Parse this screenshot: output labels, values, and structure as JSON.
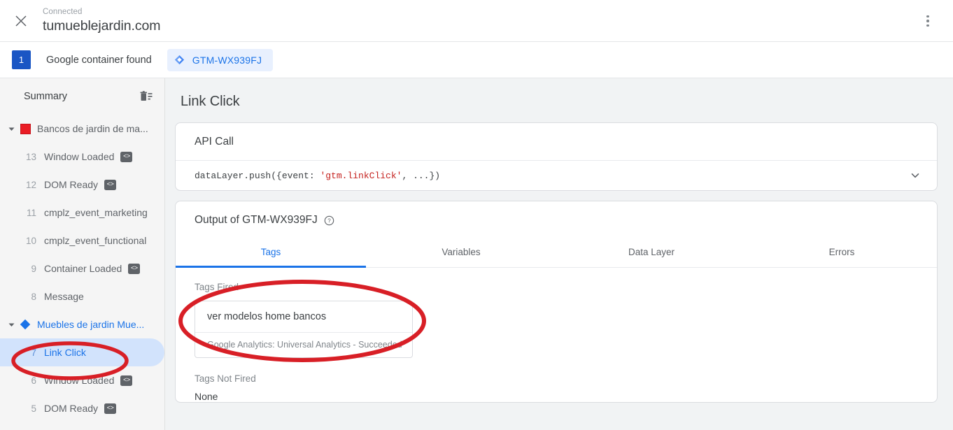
{
  "topbar": {
    "close_icon": "close-icon",
    "connection_status": "Connected",
    "domain": "tumueblejardin.com",
    "menu_icon": "more-vert-icon"
  },
  "container_bar": {
    "count": "1",
    "label": "Google container found",
    "chip_icon": "tag-manager-diamond-icon",
    "chip_id": "GTM-WX939FJ"
  },
  "sidebar": {
    "summary_label": "Summary",
    "clear_icon": "delete-list-icon",
    "groups": [
      {
        "caret": "caret-down-icon",
        "icon": "red-square-icon",
        "label": "Bancos de jardin de ma...",
        "events": [
          {
            "num": "13",
            "name": "Window Loaded",
            "badge": "<>"
          },
          {
            "num": "12",
            "name": "DOM Ready",
            "badge": "<>"
          },
          {
            "num": "11",
            "name": "cmplz_event_marketing",
            "badge": ""
          },
          {
            "num": "10",
            "name": "cmplz_event_functional",
            "badge": ""
          },
          {
            "num": "9",
            "name": "Container Loaded",
            "badge": "<>"
          },
          {
            "num": "8",
            "name": "Message",
            "badge": ""
          }
        ]
      },
      {
        "caret": "caret-down-icon",
        "icon": "blue-diamond-icon",
        "label": "Muebles de jardin Mue...",
        "events": [
          {
            "num": "7",
            "name": "Link Click",
            "badge": "",
            "selected": true
          },
          {
            "num": "6",
            "name": "Window Loaded",
            "badge": "<>"
          },
          {
            "num": "5",
            "name": "DOM Ready",
            "badge": "<>"
          }
        ]
      }
    ]
  },
  "main": {
    "title": "Link Click",
    "api_card": {
      "heading": "API Call",
      "code_prefix": "dataLayer.push({event: ",
      "code_string": "'gtm.linkClick'",
      "code_suffix": ", ...})",
      "expand_icon": "chevron-down-icon"
    },
    "output_card": {
      "heading": "Output of GTM-WX939FJ",
      "help_icon": "help-circle-icon",
      "tabs": [
        {
          "label": "Tags",
          "active": true
        },
        {
          "label": "Variables",
          "active": false
        },
        {
          "label": "Data Layer",
          "active": false
        },
        {
          "label": "Errors",
          "active": false
        }
      ],
      "tags_fired_label": "Tags Fired",
      "fired_tag": {
        "name": "ver modelos home bancos",
        "status": "Google Analytics: Universal Analytics - Succeeded"
      },
      "tags_not_fired_label": "Tags Not Fired",
      "tags_not_fired_value": "None"
    }
  },
  "colors": {
    "accent_blue": "#1a73e8",
    "chip_bg": "#e8f0fe",
    "selected_row": "#d2e3fc",
    "badge_blue": "#1a56c4",
    "group_red": "#ea1c24",
    "code_string_red": "#c5221f",
    "annotation_red": "#d81f26",
    "main_bg": "#f1f3f4",
    "sidebar_bg": "#f5f5f5"
  },
  "annotations": [
    {
      "name": "sidebar-link-click-highlight",
      "shape": "ellipse"
    },
    {
      "name": "fired-tag-highlight",
      "shape": "ellipse"
    }
  ]
}
